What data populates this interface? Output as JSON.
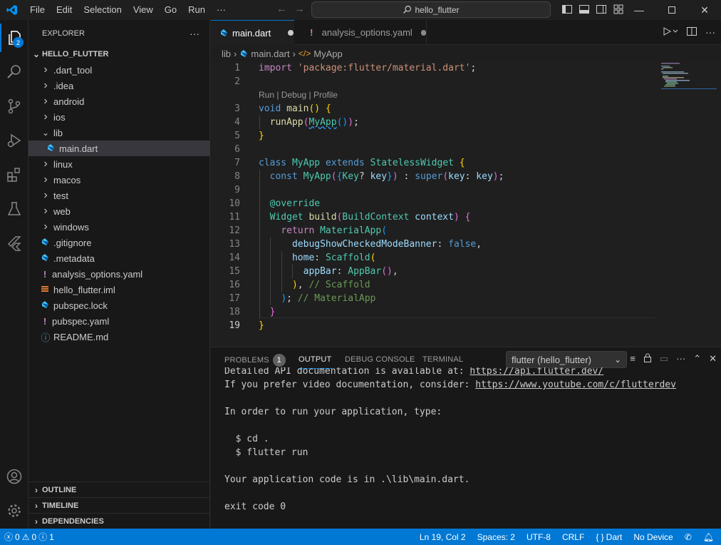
{
  "titlebar": {
    "menus": [
      "File",
      "Edit",
      "Selection",
      "View",
      "Go",
      "Run",
      "···"
    ],
    "search_text": "hello_flutter"
  },
  "activity": {
    "explorer_badge": "2"
  },
  "sidebar": {
    "header": "EXPLORER",
    "more": "···",
    "root": "HELLO_FLUTTER",
    "items": [
      {
        "label": ".dart_tool",
        "kind": "folder"
      },
      {
        "label": ".idea",
        "kind": "folder"
      },
      {
        "label": "android",
        "kind": "folder"
      },
      {
        "label": "ios",
        "kind": "folder"
      },
      {
        "label": "lib",
        "kind": "folder-open"
      },
      {
        "label": "main.dart",
        "kind": "dart"
      },
      {
        "label": "linux",
        "kind": "folder"
      },
      {
        "label": "macos",
        "kind": "folder"
      },
      {
        "label": "test",
        "kind": "folder"
      },
      {
        "label": "web",
        "kind": "folder"
      },
      {
        "label": "windows",
        "kind": "folder"
      },
      {
        "label": ".gitignore",
        "kind": "dart"
      },
      {
        "label": ".metadata",
        "kind": "dart"
      },
      {
        "label": "analysis_options.yaml",
        "kind": "yaml"
      },
      {
        "label": "hello_flutter.iml",
        "kind": "iml"
      },
      {
        "label": "pubspec.lock",
        "kind": "dart"
      },
      {
        "label": "pubspec.yaml",
        "kind": "yaml"
      },
      {
        "label": "README.md",
        "kind": "info"
      }
    ],
    "sections": [
      "OUTLINE",
      "TIMELINE",
      "DEPENDENCIES"
    ]
  },
  "tabs": [
    {
      "label": "main.dart"
    },
    {
      "label": "analysis_options.yaml"
    }
  ],
  "breadcrumb": {
    "p1": "lib",
    "p2": "main.dart",
    "p3": "MyApp"
  },
  "editor": {
    "codelens": "Run | Debug | Profile",
    "line_numbers": [
      "1",
      "2",
      "3",
      "4",
      "5",
      "6",
      "7",
      "8",
      "9",
      "10",
      "11",
      "12",
      "13",
      "14",
      "15",
      "16",
      "17",
      "18",
      "19"
    ]
  },
  "panel": {
    "tabs": [
      "PROBLEMS",
      "OUTPUT",
      "DEBUG CONSOLE",
      "TERMINAL"
    ],
    "problems_count": "1",
    "channel": "flutter (hello_flutter)",
    "output": {
      "l1a": "Detailed API documentation is available at: ",
      "l1b": "https://api.flutter.dev/",
      "l2a": "If you prefer video documentation, consider: ",
      "l2b": "https://www.youtube.com/c/flutterdev",
      "l3": "In order to run your application, type:",
      "l4": "  $ cd .",
      "l5": "  $ flutter run",
      "l6": "Your application code is in .\\lib\\main.dart.",
      "l7": "exit code 0"
    }
  },
  "status": {
    "errors": "0",
    "warnings": "0",
    "info": "1",
    "position": "Ln 19, Col 2",
    "spaces": "Spaces: 2",
    "encoding": "UTF-8",
    "eol": "CRLF",
    "language": "Dart",
    "language_icon": "{ }",
    "device": "No Device"
  },
  "colors": {
    "accent": "#0078d4",
    "status_bg": "#0078d4"
  }
}
